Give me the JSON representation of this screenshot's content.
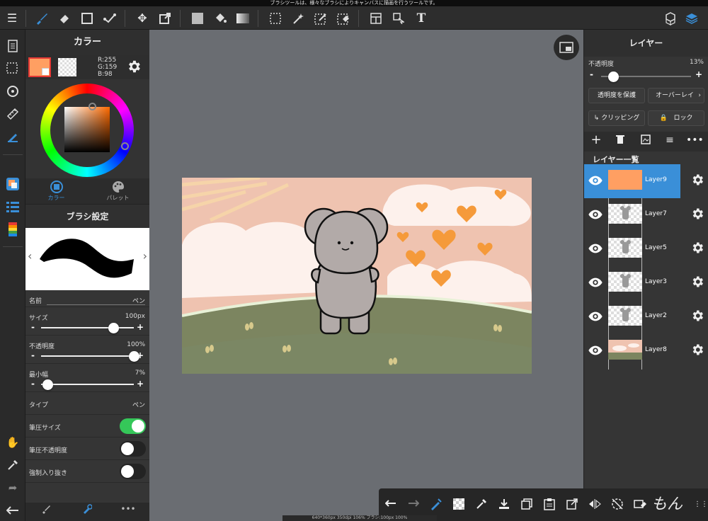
{
  "tooltip": "ブラシツールは、様々なブラシによりキャンバスに描画を行うツールです。",
  "colors": {
    "accent": "#3a8fd8",
    "main_color": "#FF9F62",
    "toggle_on": "#35c759"
  },
  "color_panel": {
    "title": "カラー",
    "r": "R:255",
    "g": "G:159",
    "b": "B:98",
    "tab_color": "カラー",
    "tab_palette": "パレット"
  },
  "brush_panel": {
    "title": "ブラシ設定",
    "name_label": "名前",
    "name_value": "ペン",
    "size_label": "サイズ",
    "size_value": "100px",
    "size_level": 0.78,
    "opacity_label": "不透明度",
    "opacity_value": "100%",
    "opacity_level": 1.0,
    "minwidth_label": "最小幅",
    "minwidth_value": "7%",
    "minwidth_level": 0.07,
    "type_label": "タイプ",
    "type_value": "ペン",
    "pressure_size": "筆圧サイズ",
    "pressure_opacity": "筆圧不透明度",
    "force_fade": "強制入り抜き",
    "minus": "-",
    "plus": "+"
  },
  "layer_panel": {
    "title": "レイヤー",
    "opacity_label": "不透明度",
    "opacity_value": "13%",
    "opacity_level": 0.13,
    "protect_alpha": "透明度を保護",
    "blend": "オーバーレイ",
    "clipping": "クリッピング",
    "lock": "ロック",
    "list_header": "レイヤー一覧",
    "layers": [
      {
        "name": "Layer9",
        "selected": true
      },
      {
        "name": "Layer7",
        "selected": false
      },
      {
        "name": "Layer5",
        "selected": false
      },
      {
        "name": "Layer3",
        "selected": false
      },
      {
        "name": "Layer2",
        "selected": false
      },
      {
        "name": "Layer8",
        "selected": false
      }
    ]
  },
  "status_bar": "640*360px 350dpi 106% ブラシ:100px 100%",
  "top_toolbar_text_tool": "T",
  "signature": "もん"
}
